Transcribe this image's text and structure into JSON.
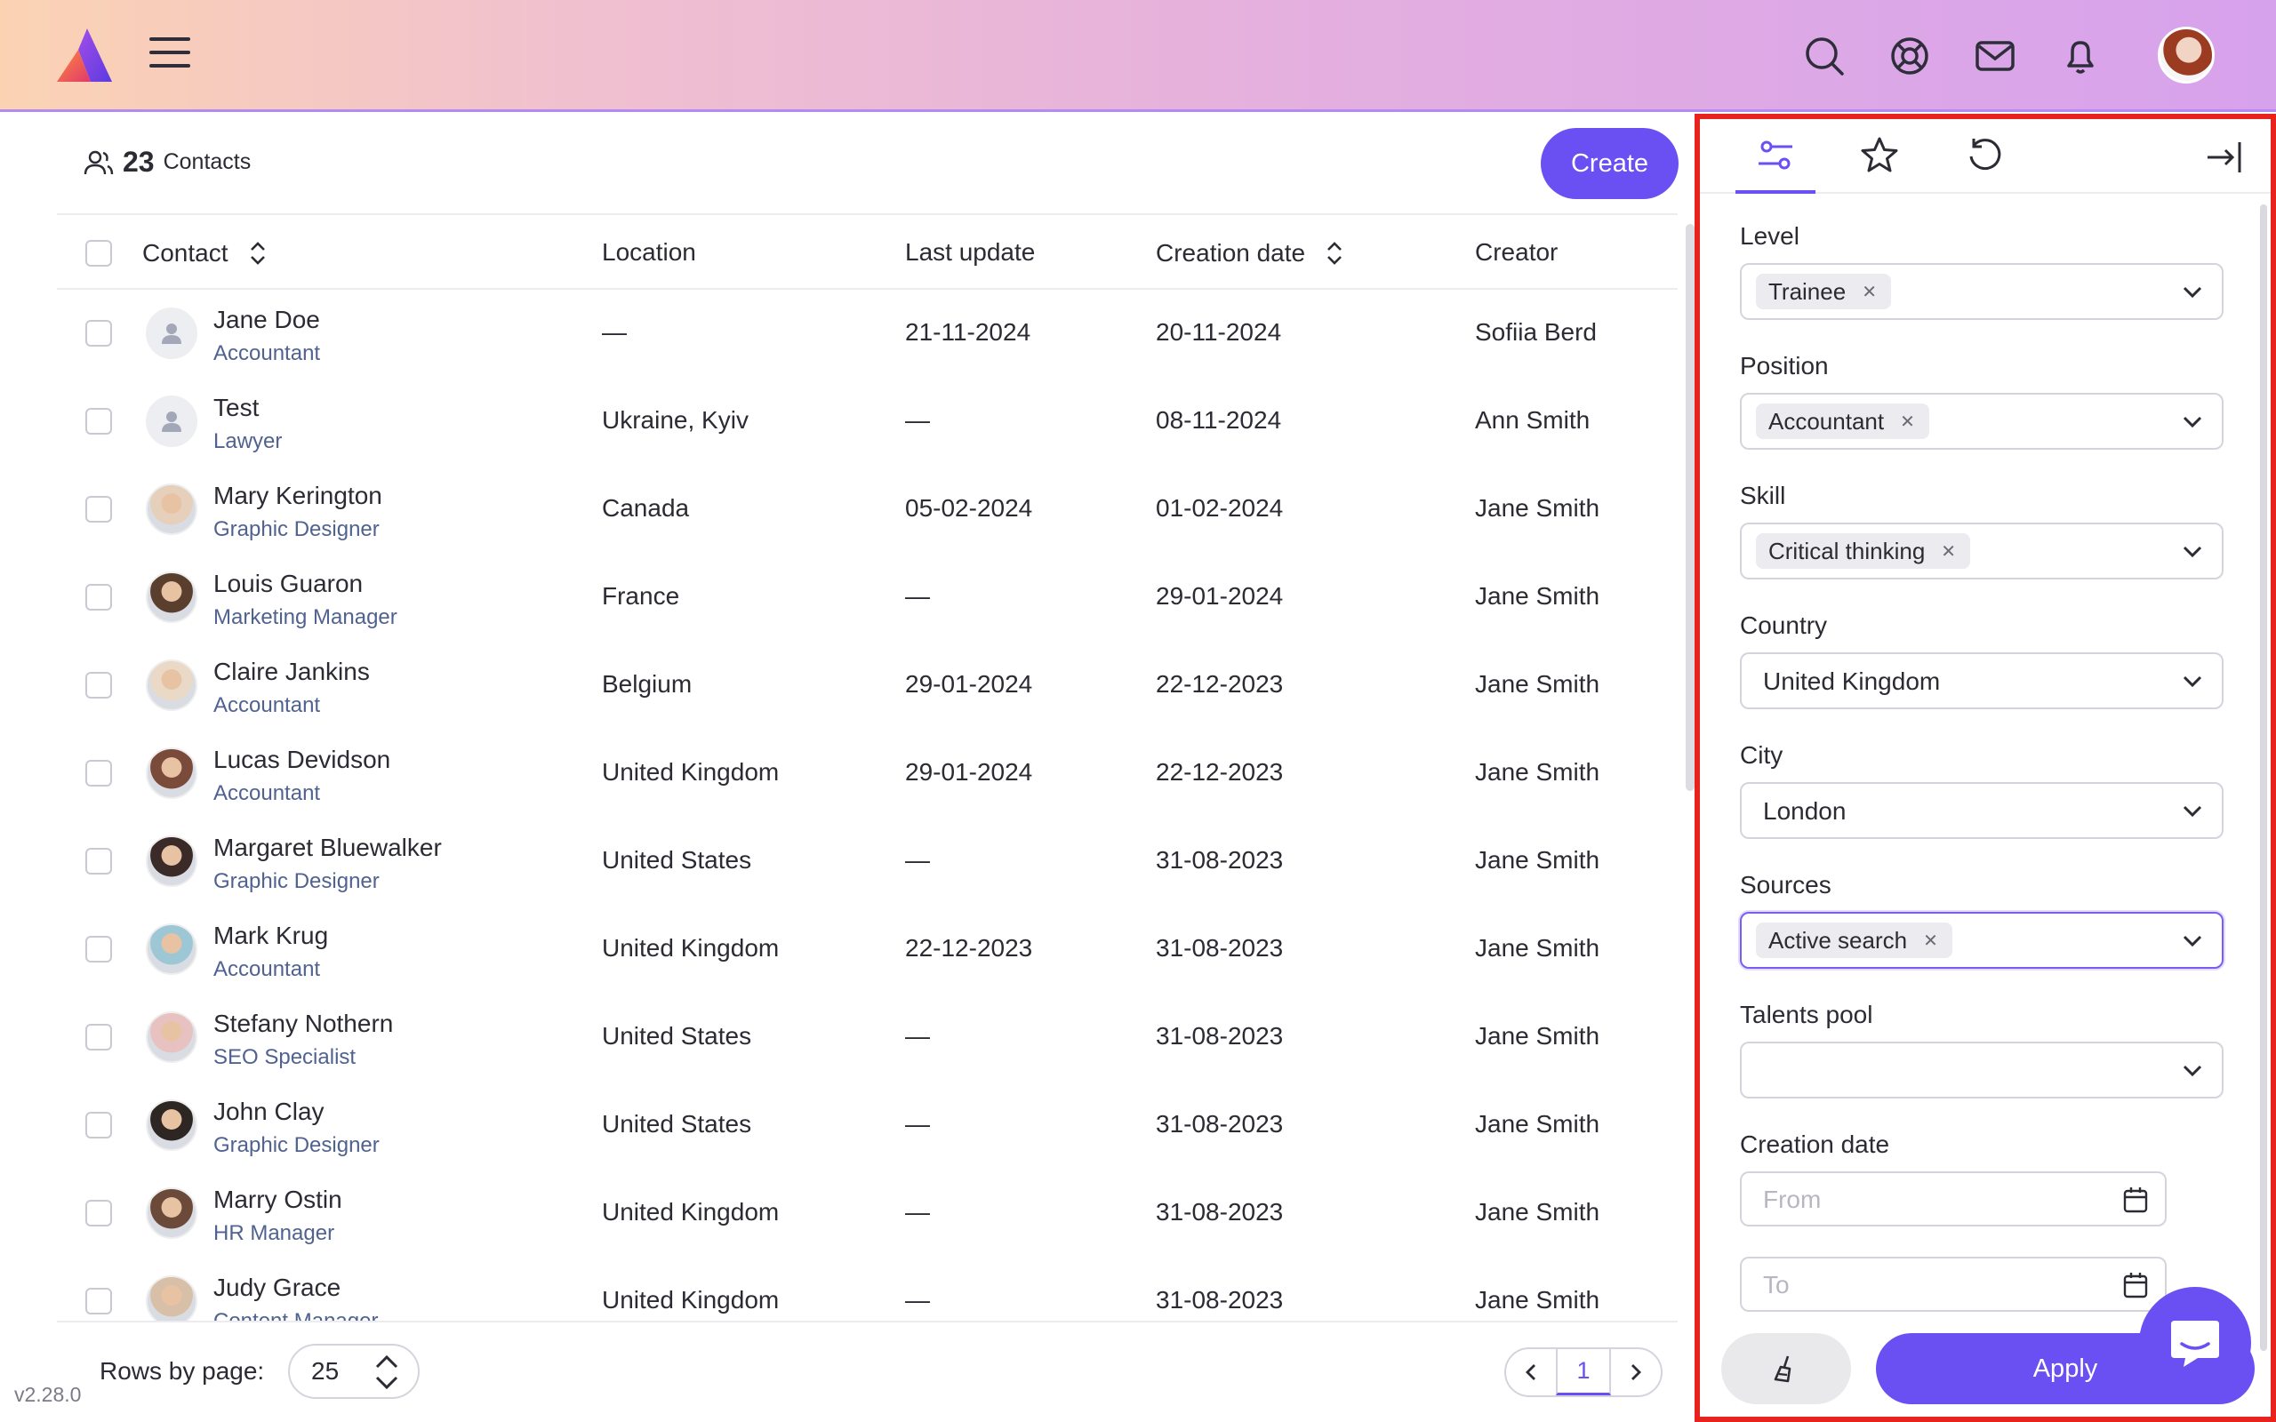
{
  "header": {
    "icons": [
      "menu-icon",
      "search-icon",
      "lifebuoy-icon",
      "mail-icon",
      "bell-icon"
    ],
    "accent": "#6a4ff2"
  },
  "contacts": {
    "count": "23",
    "count_label": "Contacts",
    "create_label": "Create"
  },
  "table": {
    "columns": {
      "contact": "Contact",
      "location": "Location",
      "last_update": "Last update",
      "creation_date": "Creation date",
      "creator": "Creator"
    },
    "rows": [
      {
        "name": "Jane Doe",
        "position": "Accountant",
        "location": "—",
        "last_update": "21-11-2024",
        "creation_date": "20-11-2024",
        "creator": "Sofiia Berd",
        "avatar": "placeholder"
      },
      {
        "name": "Test",
        "position": "Lawyer",
        "location": "Ukraine, Kyiv",
        "last_update": "—",
        "creation_date": "08-11-2024",
        "creator": "Ann Smith",
        "avatar": "placeholder"
      },
      {
        "name": "Mary Kerington",
        "position": "Graphic Designer",
        "location": "Canada",
        "last_update": "05-02-2024",
        "creation_date": "01-02-2024",
        "creator": "Jane Smith",
        "avatar": "photo"
      },
      {
        "name": "Louis Guaron",
        "position": "Marketing Manager",
        "location": "France",
        "last_update": "—",
        "creation_date": "29-01-2024",
        "creator": "Jane Smith",
        "avatar": "photo"
      },
      {
        "name": "Claire Jankins",
        "position": "Accountant",
        "location": "Belgium",
        "last_update": "29-01-2024",
        "creation_date": "22-12-2023",
        "creator": "Jane Smith",
        "avatar": "photo"
      },
      {
        "name": "Lucas Devidson",
        "position": "Accountant",
        "location": "United Kingdom",
        "last_update": "29-01-2024",
        "creation_date": "22-12-2023",
        "creator": "Jane Smith",
        "avatar": "photo"
      },
      {
        "name": "Margaret Bluewalker",
        "position": "Graphic Designer",
        "location": "United States",
        "last_update": "—",
        "creation_date": "31-08-2023",
        "creator": "Jane Smith",
        "avatar": "photo"
      },
      {
        "name": "Mark Krug",
        "position": "Accountant",
        "location": "United Kingdom",
        "last_update": "22-12-2023",
        "creation_date": "31-08-2023",
        "creator": "Jane Smith",
        "avatar": "photo"
      },
      {
        "name": "Stefany Nothern",
        "position": "SEO Specialist",
        "location": "United States",
        "last_update": "—",
        "creation_date": "31-08-2023",
        "creator": "Jane Smith",
        "avatar": "photo"
      },
      {
        "name": "John Clay",
        "position": "Graphic Designer",
        "location": "United States",
        "last_update": "—",
        "creation_date": "31-08-2023",
        "creator": "Jane Smith",
        "avatar": "photo"
      },
      {
        "name": "Marry Ostin",
        "position": "HR Manager",
        "location": "United Kingdom",
        "last_update": "—",
        "creation_date": "31-08-2023",
        "creator": "Jane Smith",
        "avatar": "photo"
      },
      {
        "name": "Judy Grace",
        "position": "Content Manager",
        "location": "United Kingdom",
        "last_update": "—",
        "creation_date": "31-08-2023",
        "creator": "Jane Smith",
        "avatar": "photo"
      }
    ]
  },
  "footer": {
    "rows_label": "Rows by page:",
    "rows_value": "25",
    "page": "1",
    "version": "v2.28.0"
  },
  "filters": {
    "tabs": [
      "filters-icon",
      "star-icon",
      "history-icon"
    ],
    "level": {
      "label": "Level",
      "chip": "Trainee"
    },
    "position": {
      "label": "Position",
      "chip": "Accountant"
    },
    "skill": {
      "label": "Skill",
      "chip": "Critical thinking"
    },
    "country": {
      "label": "Country",
      "value": "United Kingdom"
    },
    "city": {
      "label": "City",
      "value": "London"
    },
    "sources": {
      "label": "Sources",
      "chip": "Active search"
    },
    "talents_pool": {
      "label": "Talents pool",
      "value": ""
    },
    "creation_date": {
      "label": "Creation date",
      "from_placeholder": "From",
      "to_placeholder": "To"
    },
    "apply_label": "Apply"
  }
}
